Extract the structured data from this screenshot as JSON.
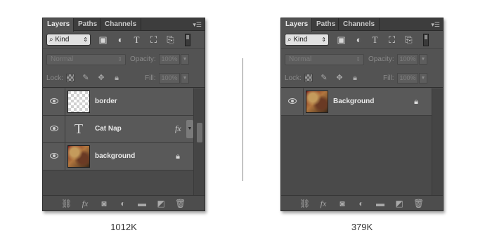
{
  "left_panel": {
    "tabs": [
      "Layers",
      "Paths",
      "Channels"
    ],
    "menu_icon": "panel-menu-icon",
    "kind_filter": "Kind",
    "blend_mode": "Normal",
    "opacity_label": "Opacity:",
    "opacity_value": "100%",
    "lock_label": "Lock:",
    "fill_label": "Fill:",
    "fill_value": "100%",
    "layers": [
      {
        "name": "border",
        "thumb": "transparent",
        "visible": true
      },
      {
        "name": "Cat Nap",
        "thumb": "text",
        "thumb_glyph": "T",
        "visible": true,
        "fx": "fx"
      },
      {
        "name": "background",
        "thumb": "photo",
        "visible": true,
        "locked": true
      }
    ],
    "file_size": "1012K"
  },
  "right_panel": {
    "tabs": [
      "Layers",
      "Paths",
      "Channels"
    ],
    "menu_icon": "panel-menu-icon",
    "kind_filter": "Kind",
    "blend_mode": "Normal",
    "opacity_label": "Opacity:",
    "opacity_value": "100%",
    "lock_label": "Lock:",
    "fill_label": "Fill:",
    "fill_value": "100%",
    "layers": [
      {
        "name": "Background",
        "thumb": "photo",
        "visible": true,
        "locked": true
      }
    ],
    "file_size": "379K"
  },
  "colors": {
    "panel_bg": "#535353",
    "tab_bar_bg": "#3d3d3d",
    "layer_row_bg": "#595959",
    "text_bright": "#eaeaea"
  }
}
